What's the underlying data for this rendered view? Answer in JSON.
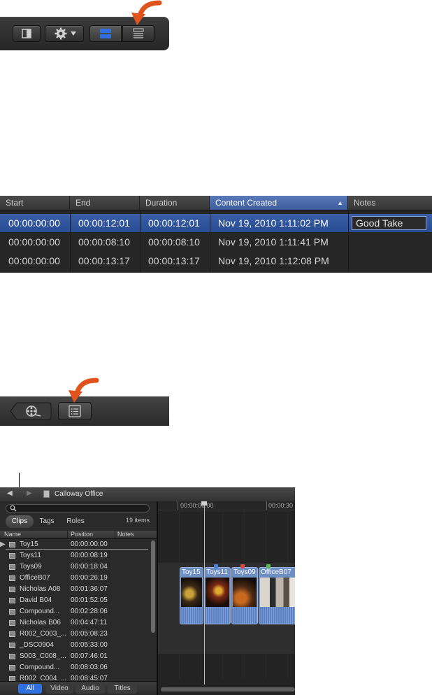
{
  "toolbar_top": {
    "buttons": [
      "viewer-toggle",
      "action-gear",
      "filmstrip-view",
      "list-view"
    ]
  },
  "table": {
    "columns": [
      "Start",
      "End",
      "Duration",
      "Content Created",
      "Notes"
    ],
    "sorted_column_indicator": "▲",
    "rows": [
      {
        "start": "00:00:00:00",
        "end": "00:00:12:01",
        "duration": "00:00:12:01",
        "created": "Nov 19, 2010 1:11:02 PM",
        "notes": "Good Take"
      },
      {
        "start": "00:00:00:00",
        "end": "00:00:08:10",
        "duration": "00:00:08:10",
        "created": "Nov 19, 2010 1:11:41 PM",
        "notes": ""
      },
      {
        "start": "00:00:00:00",
        "end": "00:00:13:17",
        "duration": "00:00:13:17",
        "created": "Nov 19, 2010 1:12:08 PM",
        "notes": ""
      }
    ]
  },
  "browser": {
    "project_title": "Calloway Office",
    "filter_tabs": [
      "Clips",
      "Tags",
      "Roles"
    ],
    "item_count": "19 items",
    "list_headers": [
      "Name",
      "Position",
      "Notes"
    ],
    "items": [
      {
        "name": "Toy15",
        "position": "00:00:00:00"
      },
      {
        "name": "Toys11",
        "position": "00:00:08:19"
      },
      {
        "name": "Toys09",
        "position": "00:00:18:04"
      },
      {
        "name": "OfficeB07",
        "position": "00:00:26:19"
      },
      {
        "name": "Nicholas A08",
        "position": "00:01:36:07"
      },
      {
        "name": "David B04",
        "position": "00:01:52:05"
      },
      {
        "name": "Compound...",
        "position": "00:02:28:06"
      },
      {
        "name": "Nicholas B06",
        "position": "00:04:47:11"
      },
      {
        "name": "R002_C003_...",
        "position": "00:05:08:23"
      },
      {
        "name": "_DSC0904",
        "position": "00:05:33:00"
      },
      {
        "name": "S003_C008_...",
        "position": "00:07:46:01"
      },
      {
        "name": "Compound...",
        "position": "00:08:03:06"
      },
      {
        "name": "R002_C004_...",
        "position": "00:08:45:07"
      }
    ],
    "bottom_tabs": [
      "All",
      "Video",
      "Audio",
      "Titles"
    ],
    "ruler_labels": [
      "00:00:00:00",
      "00:00:30"
    ],
    "clips": [
      {
        "label": "Toy15",
        "marker": ""
      },
      {
        "label": "Toys11",
        "marker": "#4a7fd8"
      },
      {
        "label": "Toys09",
        "marker": "#d84a4a"
      },
      {
        "label": "OfficeB07",
        "marker": "#5cb85c"
      }
    ]
  }
}
